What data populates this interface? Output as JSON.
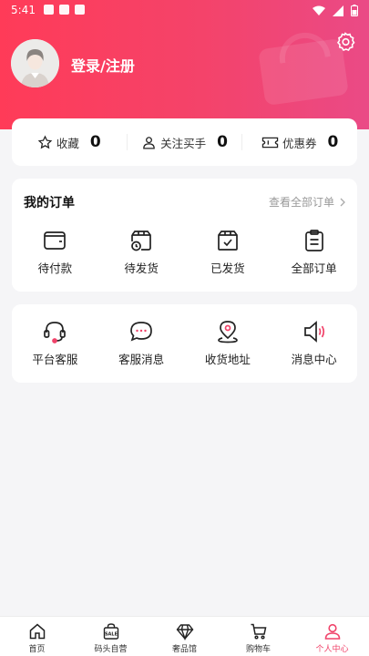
{
  "status_bar": {
    "time": "5:41"
  },
  "header": {
    "login_label": "登录/注册"
  },
  "stats": [
    {
      "icon": "star-icon",
      "label": "收藏",
      "value": "0"
    },
    {
      "icon": "person-icon",
      "label": "关注买手",
      "value": "0"
    },
    {
      "icon": "coupon-icon",
      "label": "优惠券",
      "value": "0"
    }
  ],
  "orders": {
    "title": "我的订单",
    "view_all": "查看全部订单",
    "items": [
      {
        "icon": "wallet-icon",
        "label": "待付款"
      },
      {
        "icon": "box-clock-icon",
        "label": "待发货"
      },
      {
        "icon": "box-check-icon",
        "label": "已发货"
      },
      {
        "icon": "clipboard-list-icon",
        "label": "全部订单"
      }
    ]
  },
  "services": {
    "items": [
      {
        "icon": "headset-icon",
        "label": "平台客服"
      },
      {
        "icon": "chat-bubble-icon",
        "label": "客服消息"
      },
      {
        "icon": "location-pin-icon",
        "label": "收货地址"
      },
      {
        "icon": "speaker-icon",
        "label": "消息中心"
      }
    ]
  },
  "tabbar": {
    "items": [
      {
        "icon": "home-icon",
        "label": "首页"
      },
      {
        "icon": "sale-bag-icon",
        "label": "码头自营"
      },
      {
        "icon": "diamond-icon",
        "label": "奢品馆"
      },
      {
        "icon": "cart-icon",
        "label": "购物车"
      },
      {
        "icon": "profile-icon",
        "label": "个人中心"
      }
    ],
    "active_index": 4
  },
  "colors": {
    "accent": "#f0436a",
    "header_start": "#ff3b58",
    "header_end": "#ea4a86"
  }
}
